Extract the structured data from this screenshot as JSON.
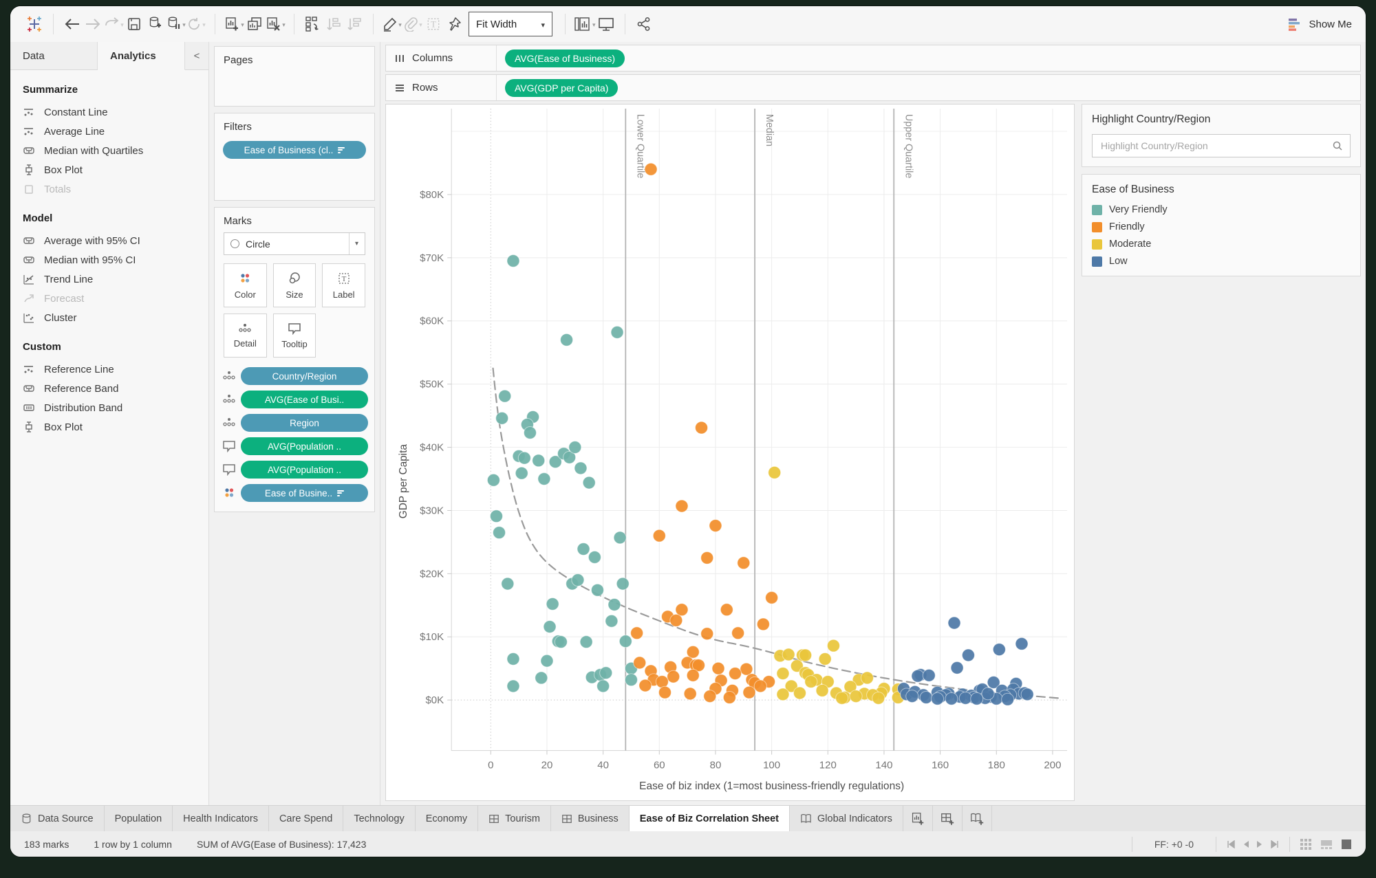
{
  "toolbar": {
    "fit_label": "Fit Width",
    "show_me_label": "Show Me",
    "show_me_colors": [
      "#8074a8",
      "#7ea6c9",
      "#f0a360",
      "#ed7d70"
    ]
  },
  "sidebar": {
    "tabs": [
      {
        "label": "Data"
      },
      {
        "label": "Analytics"
      }
    ],
    "collapse_icon": "<",
    "sections": [
      {
        "title": "Summarize",
        "items": [
          {
            "label": "Constant Line",
            "disabled": false
          },
          {
            "label": "Average Line",
            "disabled": false
          },
          {
            "label": "Median with Quartiles",
            "disabled": false
          },
          {
            "label": "Box Plot",
            "disabled": false
          },
          {
            "label": "Totals",
            "disabled": true
          }
        ]
      },
      {
        "title": "Model",
        "items": [
          {
            "label": "Average with 95% CI",
            "disabled": false
          },
          {
            "label": "Median with 95% CI",
            "disabled": false
          },
          {
            "label": "Trend Line",
            "disabled": false
          },
          {
            "label": "Forecast",
            "disabled": true
          },
          {
            "label": "Cluster",
            "disabled": false
          }
        ]
      },
      {
        "title": "Custom",
        "items": [
          {
            "label": "Reference Line",
            "disabled": false
          },
          {
            "label": "Reference Band",
            "disabled": false
          },
          {
            "label": "Distribution Band",
            "disabled": false
          },
          {
            "label": "Box Plot",
            "disabled": false
          }
        ]
      }
    ]
  },
  "cards": {
    "pages": {
      "title": "Pages"
    },
    "filters": {
      "title": "Filters",
      "pill": "Ease of Business (cl.."
    },
    "marks": {
      "title": "Marks",
      "mark_type": "Circle",
      "buttons": [
        {
          "label": "Color"
        },
        {
          "label": "Size"
        },
        {
          "label": "Label"
        },
        {
          "label": "Detail"
        },
        {
          "label": "Tooltip"
        }
      ],
      "pills": [
        {
          "label": "Country/Region",
          "kind": "dim",
          "icon": "detail"
        },
        {
          "label": "AVG(Ease of Busi..",
          "kind": "meas",
          "icon": "detail"
        },
        {
          "label": "Region",
          "kind": "dim",
          "icon": "detail"
        },
        {
          "label": "AVG(Population ..",
          "kind": "meas",
          "icon": "tooltip"
        },
        {
          "label": "AVG(Population ..",
          "kind": "meas",
          "icon": "tooltip"
        },
        {
          "label": "Ease of Busine..",
          "kind": "dim",
          "icon": "color",
          "sorted": true
        }
      ]
    }
  },
  "shelves": {
    "columns": {
      "label": "Columns",
      "pill": "AVG(Ease of Business)"
    },
    "rows": {
      "label": "Rows",
      "pill": "AVG(GDP per Capita)"
    }
  },
  "highlight": {
    "title": "Highlight Country/Region",
    "placeholder": "Highlight Country/Region"
  },
  "legend": {
    "title": "Ease of Business",
    "entries": [
      {
        "label": "Very Friendly",
        "color": "#6fb2a8"
      },
      {
        "label": "Friendly",
        "color": "#f28e2b"
      },
      {
        "label": "Moderate",
        "color": "#e9c63b"
      },
      {
        "label": "Low",
        "color": "#4e79a7"
      }
    ]
  },
  "sheet_tabs": [
    {
      "label": "Data Source",
      "icon": "datasource",
      "active": false
    },
    {
      "label": "Population",
      "active": false
    },
    {
      "label": "Health Indicators",
      "active": false
    },
    {
      "label": "Care Spend",
      "active": false
    },
    {
      "label": "Technology",
      "active": false
    },
    {
      "label": "Economy",
      "active": false
    },
    {
      "label": "Tourism",
      "icon": "grid",
      "active": false
    },
    {
      "label": "Business",
      "icon": "grid",
      "active": false
    },
    {
      "label": "Ease of Biz Correlation Sheet",
      "active": true
    },
    {
      "label": "Global Indicators",
      "icon": "dashboard",
      "active": false
    }
  ],
  "status_bar": {
    "marks": "183 marks",
    "size": "1 row by 1 column",
    "aggregate": "SUM of AVG(Ease of Business): 17,423",
    "ff": "FF: +0 -0"
  },
  "chart_data": {
    "type": "scatter",
    "title": "",
    "xlabel": "Ease of biz index (1=most business-friendly regulations)",
    "ylabel": "GDP per Capita",
    "xlim": [
      0,
      200
    ],
    "x_ticks": [
      0,
      20,
      40,
      60,
      80,
      100,
      120,
      140,
      160,
      180,
      200
    ],
    "ylim_thousands": [
      0,
      90
    ],
    "y_ticks": [
      {
        "v": 0,
        "label": "$0K"
      },
      {
        "v": 10,
        "label": "$10K"
      },
      {
        "v": 20,
        "label": "$20K"
      },
      {
        "v": 30,
        "label": "$30K"
      },
      {
        "v": 40,
        "label": "$40K"
      },
      {
        "v": 50,
        "label": "$50K"
      },
      {
        "v": 60,
        "label": "$60K"
      },
      {
        "v": 70,
        "label": "$70K"
      },
      {
        "v": 80,
        "label": "$80K"
      }
    ],
    "grid": true,
    "legend_position": "right",
    "reference_lines": [
      {
        "label": "Lower Quartile",
        "x": 48
      },
      {
        "label": "Median",
        "x": 94
      },
      {
        "label": "Upper Quartile",
        "x": 143.5
      }
    ],
    "trend_dashed": [
      [
        0.8,
        52.5
      ],
      [
        2,
        47
      ],
      [
        4,
        41
      ],
      [
        7,
        34.5
      ],
      [
        10,
        29.5
      ],
      [
        14,
        25
      ],
      [
        20,
        21.5
      ],
      [
        30,
        18.5
      ],
      [
        44,
        15.4
      ],
      [
        60,
        12.5
      ],
      [
        77,
        9.7
      ],
      [
        94,
        8.3
      ],
      [
        115,
        5.6
      ],
      [
        145,
        3.0
      ],
      [
        175,
        1.3
      ],
      [
        202,
        0.3
      ]
    ],
    "series": [
      {
        "name": "Very Friendly",
        "color": "#6fb2a8",
        "points": [
          [
            8,
            69.5
          ],
          [
            45,
            58.2
          ],
          [
            27,
            57
          ],
          [
            5,
            48.1
          ],
          [
            4,
            44.6
          ],
          [
            15,
            44.8
          ],
          [
            13,
            43.6
          ],
          [
            14,
            42.3
          ],
          [
            10,
            38.6
          ],
          [
            12,
            38.3
          ],
          [
            17,
            37.9
          ],
          [
            23,
            37.7
          ],
          [
            26,
            39
          ],
          [
            28,
            38.4
          ],
          [
            30,
            40
          ],
          [
            32,
            36.7
          ],
          [
            11,
            35.9
          ],
          [
            19,
            35
          ],
          [
            1,
            34.8
          ],
          [
            35,
            34.4
          ],
          [
            2,
            29.1
          ],
          [
            3,
            26.5
          ],
          [
            46,
            25.7
          ],
          [
            33,
            23.9
          ],
          [
            37,
            22.6
          ],
          [
            6,
            18.4
          ],
          [
            29,
            18.4
          ],
          [
            31,
            19
          ],
          [
            47,
            18.4
          ],
          [
            38,
            17.4
          ],
          [
            44,
            15.1
          ],
          [
            22,
            15.2
          ],
          [
            43,
            12.5
          ],
          [
            21,
            11.6
          ],
          [
            24,
            9.3
          ],
          [
            25,
            9.2
          ],
          [
            34,
            9.2
          ],
          [
            48,
            9.3
          ],
          [
            8,
            6.5
          ],
          [
            20,
            6.2
          ],
          [
            50,
            5
          ],
          [
            36,
            3.6
          ],
          [
            39,
            4
          ],
          [
            41,
            4.3
          ],
          [
            18,
            3.5
          ],
          [
            40,
            2.2
          ],
          [
            8,
            2.2
          ],
          [
            50,
            3.2
          ]
        ]
      },
      {
        "name": "Friendly",
        "color": "#f28e2b",
        "points": [
          [
            57,
            84
          ],
          [
            75,
            43.1
          ],
          [
            68,
            30.7
          ],
          [
            60,
            26
          ],
          [
            80,
            27.6
          ],
          [
            77,
            22.5
          ],
          [
            90,
            21.7
          ],
          [
            100,
            16.2
          ],
          [
            68,
            14.3
          ],
          [
            84,
            14.3
          ],
          [
            63,
            13.2
          ],
          [
            66,
            12.6
          ],
          [
            97,
            12
          ],
          [
            52,
            10.6
          ],
          [
            88,
            10.6
          ],
          [
            77,
            10.5
          ],
          [
            72,
            7.6
          ],
          [
            53,
            5.9
          ],
          [
            70,
            5.9
          ],
          [
            73,
            5.5
          ],
          [
            74,
            5.5
          ],
          [
            64,
            5.2
          ],
          [
            81,
            5
          ],
          [
            91,
            4.9
          ],
          [
            57,
            4.6
          ],
          [
            87,
            4.2
          ],
          [
            72,
            3.9
          ],
          [
            65,
            3.7
          ],
          [
            58,
            3.2
          ],
          [
            82,
            3.1
          ],
          [
            93,
            3.2
          ],
          [
            61,
            2.9
          ],
          [
            99,
            2.9
          ],
          [
            94,
            2.7
          ],
          [
            55,
            2.3
          ],
          [
            96,
            2.2
          ],
          [
            80,
            1.8
          ],
          [
            86,
            1.5
          ],
          [
            62,
            1.2
          ],
          [
            92,
            1.2
          ],
          [
            71,
            1
          ],
          [
            78,
            0.6
          ],
          [
            85,
            0.4
          ]
        ]
      },
      {
        "name": "Moderate",
        "color": "#e9c63b",
        "points": [
          [
            101,
            36
          ],
          [
            122,
            8.6
          ],
          [
            103,
            7
          ],
          [
            106,
            7.2
          ],
          [
            111,
            7.1
          ],
          [
            112,
            7.1
          ],
          [
            119,
            6.5
          ],
          [
            109,
            5.4
          ],
          [
            104,
            4.2
          ],
          [
            112,
            4.3
          ],
          [
            113,
            4
          ],
          [
            116,
            3.2
          ],
          [
            131,
            3.2
          ],
          [
            134,
            3.5
          ],
          [
            114,
            2.9
          ],
          [
            120,
            2.9
          ],
          [
            107,
            2.2
          ],
          [
            128,
            2.1
          ],
          [
            140,
            1.8
          ],
          [
            145,
            1.7
          ],
          [
            118,
            1.5
          ],
          [
            110,
            1.1
          ],
          [
            123,
            1.1
          ],
          [
            139,
            1.1
          ],
          [
            133,
            1
          ],
          [
            104,
            0.9
          ],
          [
            136,
            0.8
          ],
          [
            126,
            0.4
          ],
          [
            145,
            0.4
          ],
          [
            125,
            0.3
          ],
          [
            130,
            0.6
          ],
          [
            138,
            0.3
          ]
        ]
      },
      {
        "name": "Low",
        "color": "#4e79a7",
        "points": [
          [
            165,
            12.2
          ],
          [
            189,
            8.9
          ],
          [
            181,
            8
          ],
          [
            170,
            7.1
          ],
          [
            166,
            5.1
          ],
          [
            153,
            4
          ],
          [
            152,
            3.8
          ],
          [
            156,
            3.9
          ],
          [
            179,
            2.8
          ],
          [
            187,
            2.6
          ],
          [
            147,
            1.8
          ],
          [
            174,
            1.5
          ],
          [
            175,
            1.7
          ],
          [
            182,
            1.5
          ],
          [
            186,
            1.7
          ],
          [
            159,
            1.2
          ],
          [
            163,
            1
          ],
          [
            188,
            1
          ],
          [
            190,
            1.1
          ],
          [
            148,
            0.9
          ],
          [
            168,
            0.9
          ],
          [
            151,
            1.3
          ],
          [
            154,
            0.8
          ],
          [
            162,
            0.8
          ],
          [
            185,
            0.8
          ],
          [
            171,
            0.7
          ],
          [
            150,
            0.6
          ],
          [
            160,
            0.5
          ],
          [
            167,
            0.5
          ],
          [
            178,
            0.5
          ],
          [
            183,
            0.6
          ],
          [
            155,
            0.4
          ],
          [
            172,
            0.4
          ],
          [
            176,
            0.3
          ],
          [
            169,
            0.3
          ],
          [
            159,
            0.2
          ],
          [
            164,
            0.2
          ],
          [
            180,
            0.2
          ],
          [
            184,
            0.1
          ],
          [
            177,
            1
          ],
          [
            173,
            0.2
          ],
          [
            191,
            0.9
          ]
        ]
      }
    ]
  }
}
